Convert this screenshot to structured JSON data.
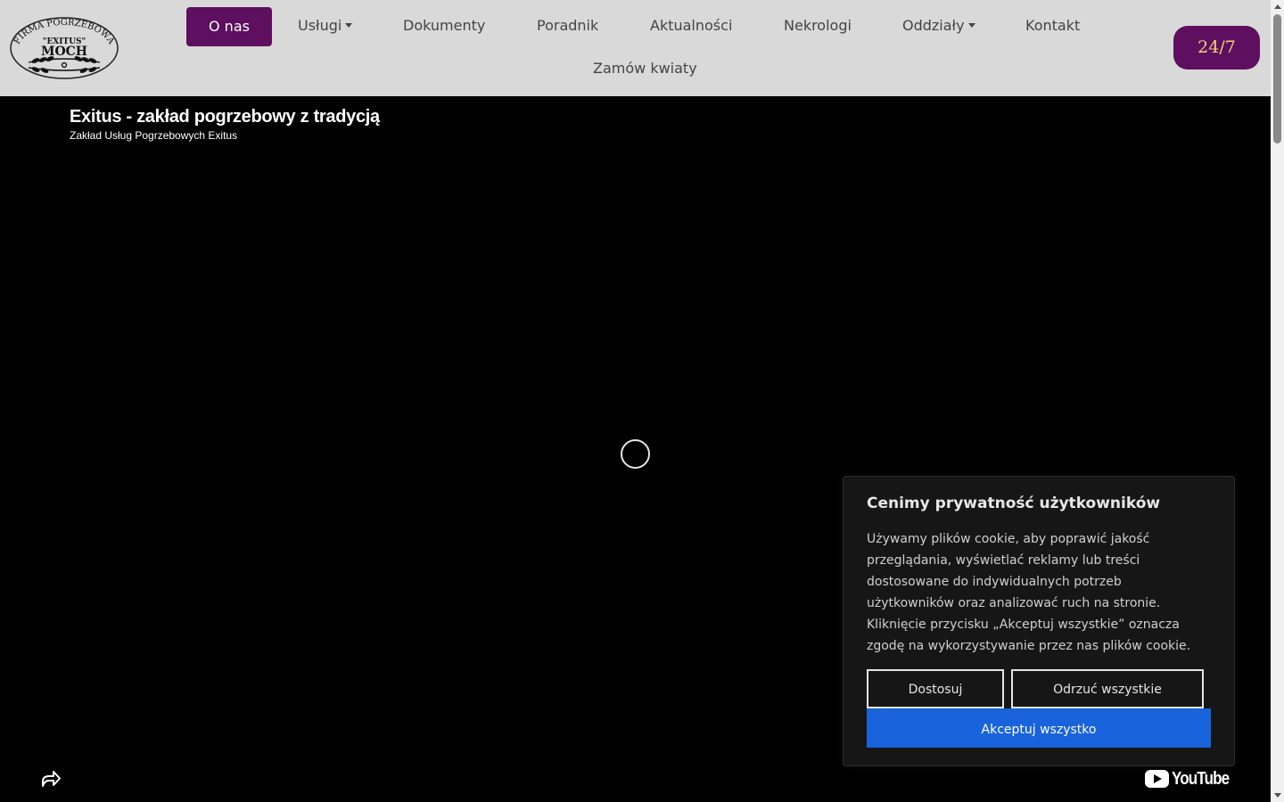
{
  "header": {
    "logo": {
      "arc_text": "FIRMA POGRZEBOWA",
      "line1": "\"EXITUS\"",
      "line2": "MOCH"
    },
    "nav": [
      {
        "label": "O nas",
        "active": true,
        "dropdown": false
      },
      {
        "label": "Usługi",
        "active": false,
        "dropdown": true
      },
      {
        "label": "Dokumenty",
        "active": false,
        "dropdown": false
      },
      {
        "label": "Poradnik",
        "active": false,
        "dropdown": false
      },
      {
        "label": "Aktualności",
        "active": false,
        "dropdown": false
      },
      {
        "label": "Nekrologi",
        "active": false,
        "dropdown": false
      },
      {
        "label": "Oddziały",
        "active": false,
        "dropdown": true
      },
      {
        "label": "Kontakt",
        "active": false,
        "dropdown": false
      },
      {
        "label": "Zamów kwiaty",
        "active": false,
        "dropdown": false
      }
    ],
    "cta_label": "24/7"
  },
  "video": {
    "title": "Exitus - zakład pogrzebowy z tradycją",
    "channel": "Zakład Usług Pogrzebowych Exitus",
    "brand": "YouTube",
    "icons": {
      "share": "share-icon",
      "loading": "loading-spinner-icon"
    }
  },
  "cookie": {
    "title": "Cenimy prywatność użytkowników",
    "body": "Używamy plików cookie, aby poprawić jakość przeglądania, wyświetlać reklamy lub treści dostosowane do indywidualnych potrzeb użytkowników oraz analizować ruch na stronie. Kliknięcie przycisku „Akceptuj wszystkie” oznacza zgodę na wykorzystywanie przez nas plików cookie.",
    "customize_label": "Dostosuj",
    "reject_label": "Odrzuć wszystkie",
    "accept_label": "Akceptuj wszystko"
  },
  "colors": {
    "brand_purple": "#5e0f5f",
    "cta_text": "#f5d27a",
    "accept_blue": "#1863dc",
    "header_bg": "#d9d9d9"
  }
}
